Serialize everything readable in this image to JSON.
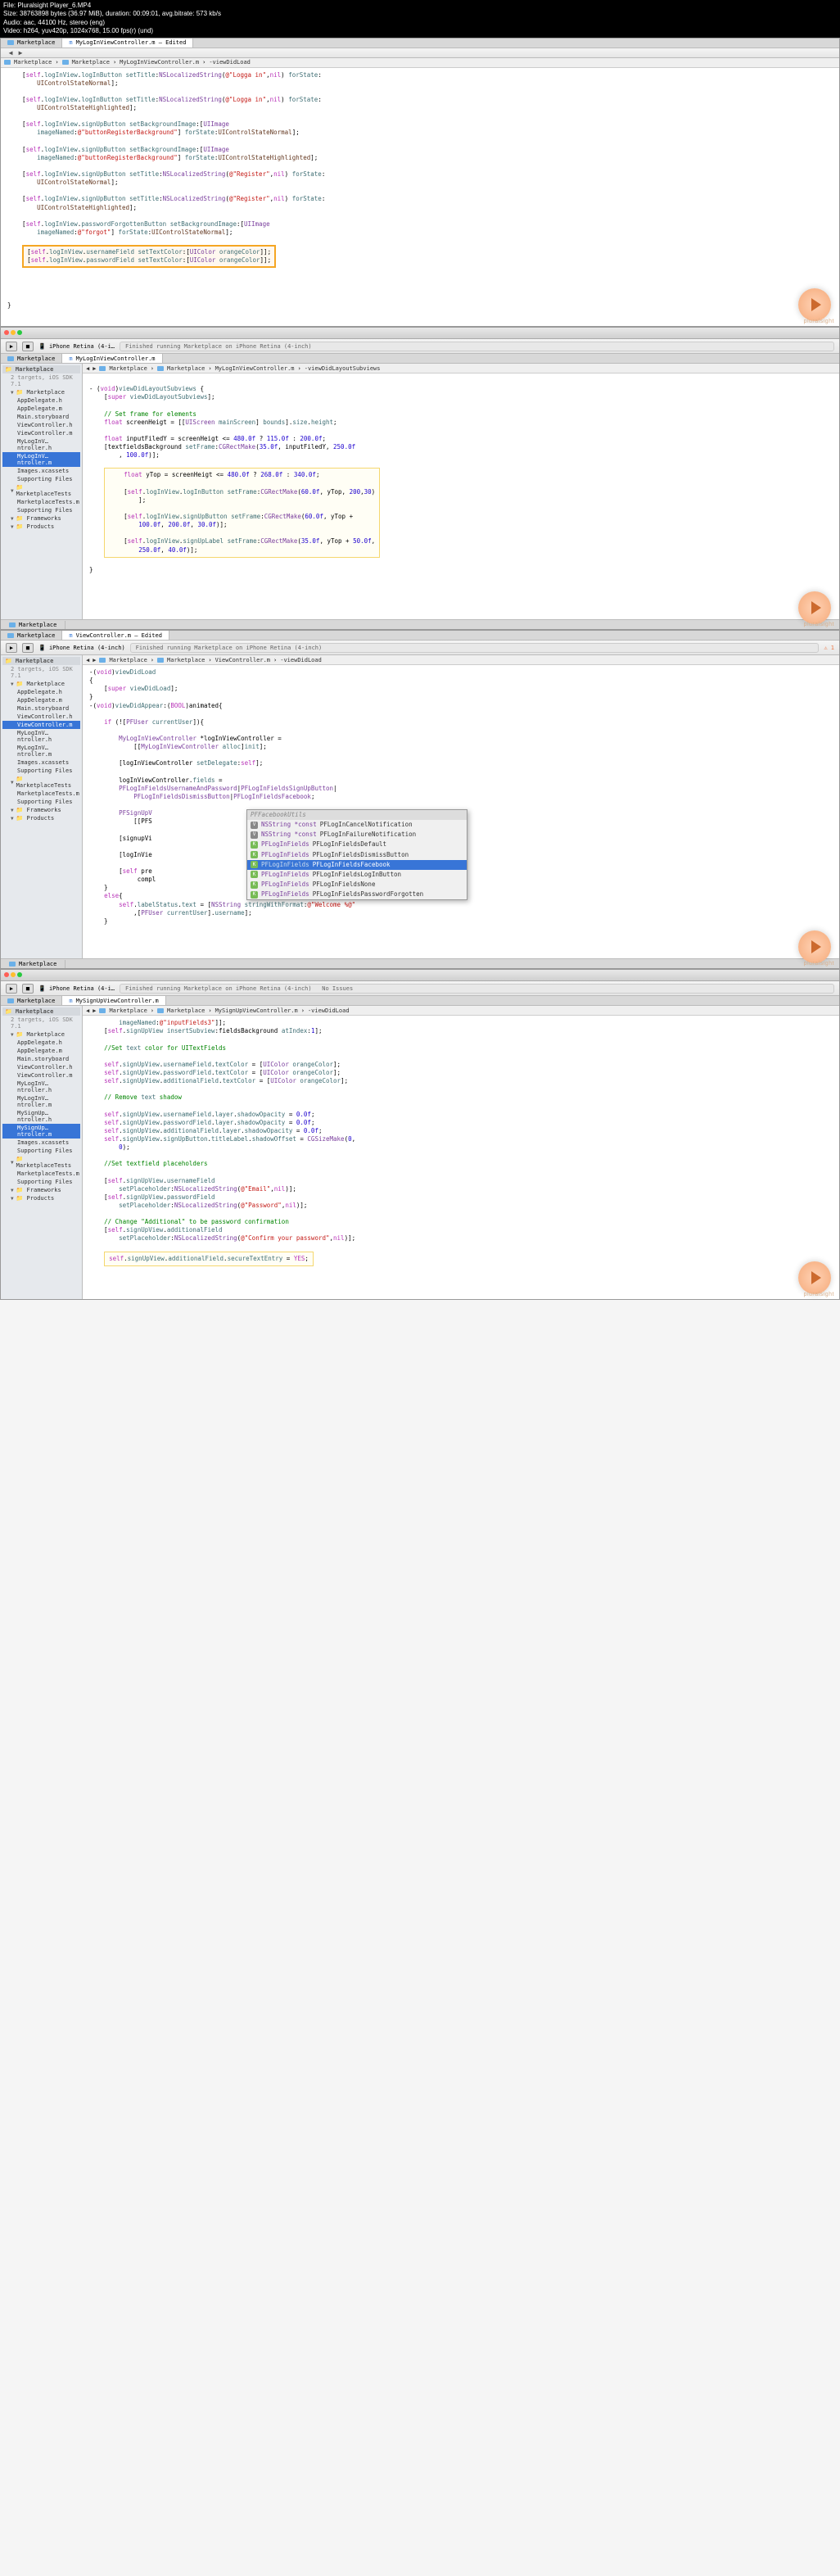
{
  "file_info": {
    "line1": "File: Pluralsight Player_6.MP4",
    "line2": "Size: 38763898 bytes (36.97 MiB), duration: 00:09:01, avg.bitrate: 573 kb/s",
    "line3": "Audio: aac, 44100 Hz, stereo (eng)",
    "line4": "Video: h264, yuv420p, 1024x768, 15.00 fps(r) (und)"
  },
  "watermark": "pluralsight",
  "shot1": {
    "tabs": [
      "Marketplace",
      "MyLogInViewController.m — Edited"
    ],
    "breadcrumb": [
      "Marketplace",
      "Marketplace",
      "MyLogInViewController.m",
      "-viewDidLoad"
    ],
    "code": [
      "    [self.logInView.logInButton setTitle:NSLocalizedString(@\"Logga in\",nil) forState:",
      "        UIControlStateNormal];",
      "",
      "    [self.logInView.logInButton setTitle:NSLocalizedString(@\"Logga in\",nil) forState:",
      "        UIControlStateHighlighted];",
      "",
      "    [self.logInView.signUpButton setBackgroundImage:[UIImage",
      "        imageNamed:@\"buttonRegisterBackground\"] forState:UIControlStateNormal];",
      "",
      "    [self.logInView.signUpButton setBackgroundImage:[UIImage",
      "        imageNamed:@\"buttonRegisterBackground\"] forState:UIControlStateHighlighted];",
      "",
      "    [self.logInView.signUpButton setTitle:NSLocalizedString(@\"Register\",nil) forState:",
      "        UIControlStateNormal];",
      "",
      "    [self.logInView.signUpButton setTitle:NSLocalizedString(@\"Register\",nil) forState:",
      "        UIControlStateHighlighted];",
      "",
      "    [self.logInView.passwordForgottenButton setBackgroundImage:[UIImage",
      "        imageNamed:@\"forgot\"] forState:UIControlStateNormal];"
    ],
    "highlighted": [
      "[self.logInView.usernameField setTextColor:[UIColor orangeColor]];",
      "[self.logInView.passwordField setTextColor:[UIColor orangeColor]];"
    ],
    "end_brace": "}"
  },
  "shot2": {
    "toolbar_device": "iPhone Retina (4-i…",
    "toolbar_status": "Finished running Marketplace on iPhone Retina (4-inch)",
    "tabs": [
      "Marketplace",
      "MyLogInViewController.m"
    ],
    "breadcrumb": [
      "Marketplace",
      "Marketplace",
      "MyLogInViewController.m",
      "-viewDidLayoutSubviews"
    ],
    "sidebar": {
      "header": "Marketplace",
      "subheader": "2 targets, iOS SDK 7.1",
      "groups": [
        {
          "name": "Marketplace",
          "items": [
            "AppDelegate.h",
            "AppDelegate.m",
            "Main.storyboard",
            "ViewController.h",
            "ViewController.m",
            "MyLogInV…ntroller.h",
            "MyLogInV…ntroller.m",
            "Images.xcassets",
            "Supporting Files"
          ]
        },
        {
          "name": "MarketplaceTests",
          "items": [
            "MarketplaceTests.m",
            "Supporting Files"
          ]
        },
        {
          "name": "Frameworks",
          "items": []
        },
        {
          "name": "Products",
          "items": []
        }
      ],
      "selected": "MyLogInV…ntroller.m"
    },
    "code_pre": [
      "- (void)viewDidLayoutSubviews {",
      "    [super viewDidLayoutSubviews];",
      "",
      "    // Set frame for elements",
      "    float screenHeigt = [[UIScreen mainScreen] bounds].size.height;",
      "",
      "    float inputFiledY = screenHeigt <= 480.0f ? 115.0f : 200.0f;",
      "    [textfieldsBackground setFrame:CGRectMake(35.0f, inputFiledY, 250.0f",
      "        , 100.0f)];"
    ],
    "highlighted": [
      "float yTop = screenHeigt <= 480.0f ? 268.0f : 340.0f;",
      "",
      "[self.logInView.logInButton setFrame:CGRectMake(60.0f, yTop, 200,30)",
      "    ];",
      "",
      "[self.logInView.signUpButton setFrame:CGRectMake(60.0f, yTop +",
      "    100.0f, 200.0f, 30.0f)];",
      "",
      "[self.logInView.signUpLabel setFrame:CGRectMake(35.0f, yTop + 50.0f,",
      "    250.0f, 40.0f)];"
    ],
    "end_brace": "}",
    "bottom_tab": "Marketplace"
  },
  "shot3": {
    "toolbar_device": "iPhone Retina (4-inch)",
    "toolbar_status": "Finished running Marketplace on iPhone Retina (4-inch)",
    "tabs": [
      "Marketplace",
      "ViewController.m — Edited"
    ],
    "breadcrumb": [
      "Marketplace",
      "Marketplace",
      "ViewController.m",
      "-viewDidLoad"
    ],
    "sidebar": {
      "header": "Marketplace",
      "subheader": "2 targets, iOS SDK 7.1",
      "groups": [
        {
          "name": "Marketplace",
          "items": [
            "AppDelegate.h",
            "AppDelegate.m",
            "Main.storyboard",
            "ViewController.h",
            "ViewController.m",
            "MyLogInV…ntroller.h",
            "MyLogInV…ntroller.m",
            "Images.xcassets",
            "Supporting Files"
          ]
        },
        {
          "name": "MarketplaceTests",
          "items": [
            "MarketplaceTests.m",
            "Supporting Files"
          ]
        },
        {
          "name": "Frameworks",
          "items": []
        },
        {
          "name": "Products",
          "items": []
        }
      ],
      "selected": "ViewController.m"
    },
    "code": [
      "-(void)viewDidLoad",
      "{",
      "    [super viewDidLoad];",
      "}",
      "-(void)viewDidAppear:(BOOL)animated{",
      "",
      "    if (![PFUser currentUser]){",
      "",
      "        MyLogInViewController *logInViewController =",
      "            [[MyLogInViewController alloc]init];",
      "",
      "        [logInViewController setDelegate:self];",
      "",
      "        logInViewController.fields =",
      "        PFLogInFieldsUsernameAndPassword|PFLogInFieldsSignUpButton|",
      "            PFLogInFieldsDismissButton|PFLogInFieldsFacebook;",
      "",
      "        PFSignUpV",
      "            [[PFS",
      "",
      "        [signupVi",
      "",
      "        [logInVie",
      "",
      "        [self pre",
      "             compl",
      "    }",
      "    else{",
      "        self.labelStatus.text = [NSString stringWithFormat:@\"Welcome %@\"",
      "            ,[PFUser currentUser].username];",
      "    }"
    ],
    "autocomplete_header": "PFFacebookUtils",
    "autocomplete": [
      {
        "type": "V",
        "left": "NSString *const",
        "right": "PFLogInCancelNotification",
        "sel": false
      },
      {
        "type": "V",
        "left": "NSString *const",
        "right": "PFLogInFailureNotification",
        "sel": false
      },
      {
        "type": "K",
        "left": "PFLogInFields",
        "right": "PFLogInFieldsDefault",
        "sel": false
      },
      {
        "type": "K",
        "left": "PFLogInFields",
        "right": "PFLogInFieldsDismissButton",
        "sel": false
      },
      {
        "type": "K",
        "left": "PFLogInFields",
        "right": "PFLogInFieldsFacebook",
        "sel": true
      },
      {
        "type": "K",
        "left": "PFLogInFields",
        "right": "PFLogInFieldsLogInButton",
        "sel": false
      },
      {
        "type": "K",
        "left": "PFLogInFields",
        "right": "PFLogInFieldsNone",
        "sel": false
      },
      {
        "type": "K",
        "left": "PFLogInFields",
        "right": "PFLogInFieldsPasswordForgotten",
        "sel": false
      }
    ],
    "bottom_tab": "Marketplace"
  },
  "shot4": {
    "toolbar_device": "iPhone Retina (4-i…",
    "toolbar_status": "Finished running Marketplace on iPhone Retina (4-inch)",
    "toolbar_issues": "No Issues",
    "tabs": [
      "Marketplace",
      "MySignUpViewController.m"
    ],
    "breadcrumb": [
      "Marketplace",
      "Marketplace",
      "MySignUpViewController.m",
      "-viewDidLoad"
    ],
    "sidebar": {
      "header": "Marketplace",
      "subheader": "2 targets, iOS SDK 7.1",
      "groups": [
        {
          "name": "Marketplace",
          "items": [
            "AppDelegate.h",
            "AppDelegate.m",
            "Main.storyboard",
            "ViewController.h",
            "ViewController.m",
            "MyLogInV…ntroller.h",
            "MyLogInV…ntroller.m",
            "MySignUp…ntroller.h",
            "MySignUp…ntroller.m",
            "Images.xcassets",
            "Supporting Files"
          ]
        },
        {
          "name": "MarketplaceTests",
          "items": [
            "MarketplaceTests.m",
            "Supporting Files"
          ]
        },
        {
          "name": "Frameworks",
          "items": []
        },
        {
          "name": "Products",
          "items": []
        }
      ],
      "selected": "MySignUp…ntroller.m"
    },
    "code": [
      "        imageNamed:@\"inputFields3\"]];",
      "    [self.signUpView insertSubview:fieldsBackground atIndex:1];",
      "",
      "    //Set text color for UITextFields",
      "",
      "    self.signUpView.usernameField.textColor = [UIColor orangeColor];",
      "    self.signUpView.passwordField.textColor = [UIColor orangeColor];",
      "    self.signUpView.additionalField.textColor = [UIColor orangeColor];",
      "",
      "    // Remove text shadow",
      "",
      "    self.signUpView.usernameField.layer.shadowOpacity = 0.0f;",
      "    self.signUpView.passwordField.layer.shadowOpacity = 0.0f;",
      "    self.signUpView.additionalField.layer.shadowOpacity = 0.0f;",
      "    self.signUpView.signUpButton.titleLabel.shadowOffset = CGSizeMake(0,",
      "        0);",
      "",
      "    //Set textfield placeholders",
      "",
      "    [self.signUpView.usernameField",
      "        setPlaceholder:NSLocalizedString(@\"Email\",nil)];",
      "    [self.signUpView.passwordField",
      "        setPlaceholder:NSLocalizedString(@\"Password\",nil)];",
      "",
      "    // Change \"Additional\" to be password confirmation",
      "    [self.signUpView.additionalField",
      "        setPlaceholder:NSLocalizedString(@\"Confirm your password\",nil)];"
    ],
    "highlighted": [
      "self.signUpView.additionalField.secureTextEntry = YES;"
    ]
  }
}
